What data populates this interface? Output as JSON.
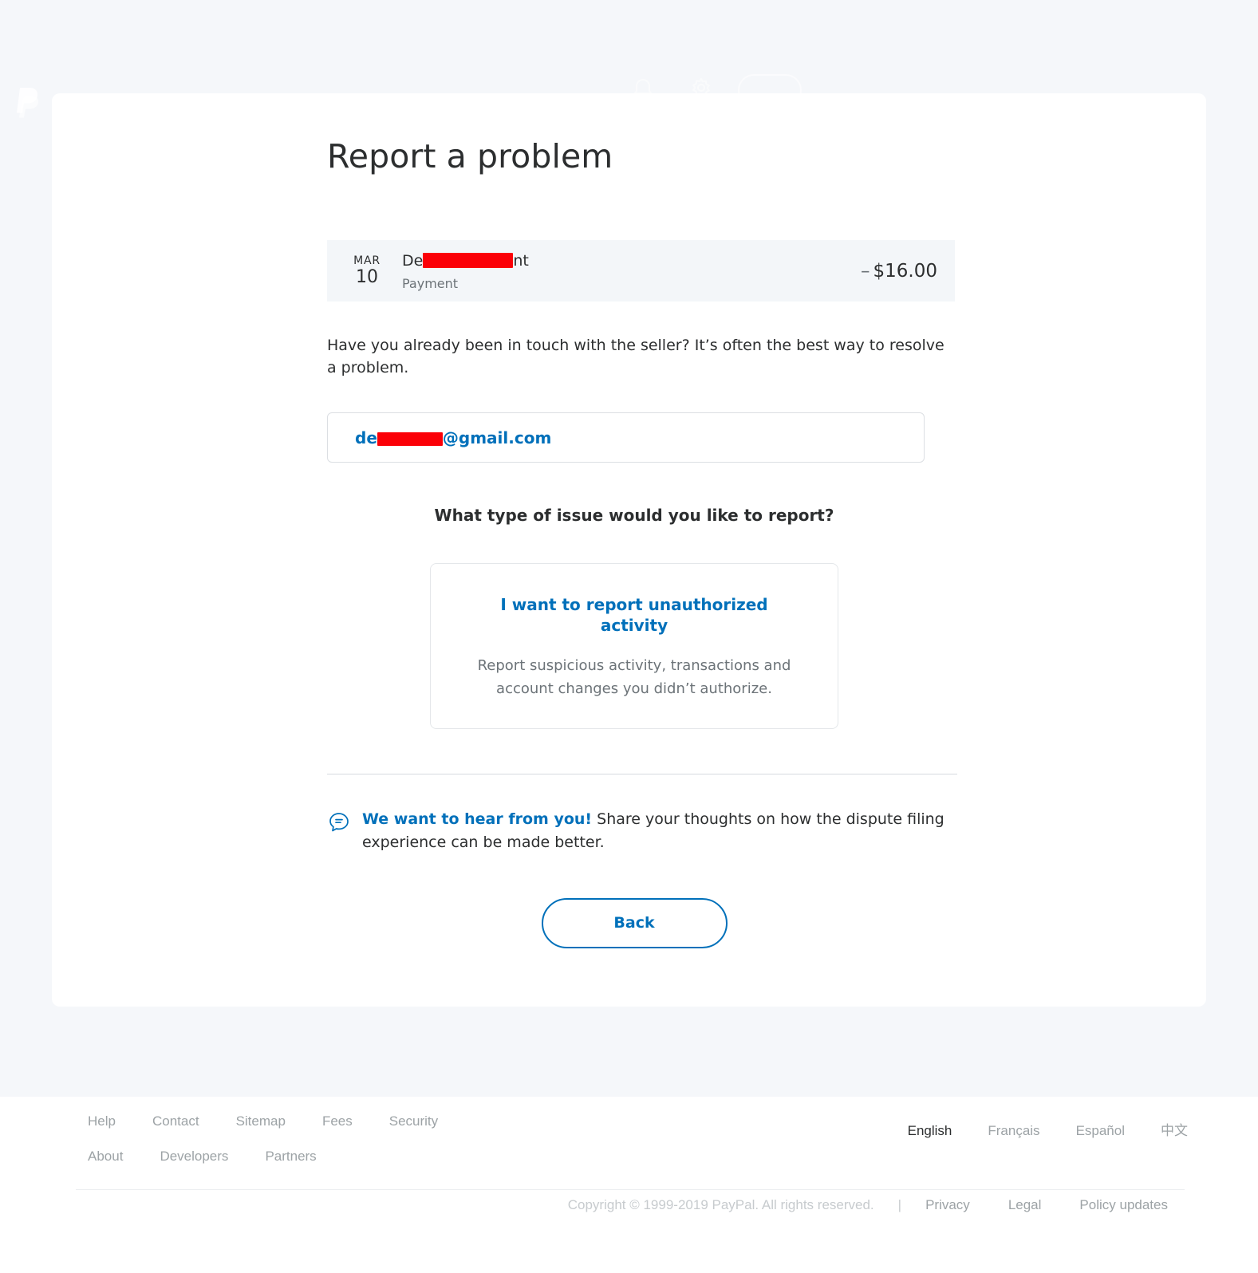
{
  "brand": {
    "logo_icon": "paypal-logo-icon",
    "accent_color": "#0070ba",
    "text_color": "#2c2e2f",
    "muted_color": "#6c7378",
    "page_bg": "#f5f7fa",
    "row_bg": "#f3f6f9",
    "redaction_color": "#fb0007"
  },
  "header": {
    "bell_icon": "bell-icon",
    "gear_icon": "gear-icon",
    "pill_button_label": ""
  },
  "main": {
    "title": "Report a problem",
    "transaction": {
      "month": "MAR",
      "day": "10",
      "merchant_prefix": "De",
      "merchant_suffix": "nt",
      "type": "Payment",
      "amount_sign": "–",
      "amount": "$16.00"
    },
    "seller_question": "Have you already been in touch with the seller? It’s often the best way to resolve a problem.",
    "email": {
      "prefix": "de",
      "suffix": "@gmail.com"
    },
    "issue_question": "What type of issue would you like to report?",
    "options": [
      {
        "title": "I want to report unauthorized activity",
        "description": "Report suspicious activity, transactions and account changes you didn’t authorize."
      }
    ],
    "feedback": {
      "icon": "chat-bubble-icon",
      "link_text": "We want to hear from you!",
      "body_text": " Share your thoughts on how the dispute filing experience can be made better."
    },
    "back_button": "Back"
  },
  "footer": {
    "links_row1": [
      "Help",
      "Contact",
      "Sitemap",
      "Fees",
      "Security"
    ],
    "links_row2": [
      "About",
      "Developers",
      "Partners"
    ],
    "languages": [
      {
        "label": "English",
        "active": true
      },
      {
        "label": "Français",
        "active": false
      },
      {
        "label": "Español",
        "active": false
      },
      {
        "label": "中文",
        "active": false
      }
    ],
    "copyright": "Copyright © 1999-2019 PayPal. All rights reserved.",
    "separator": "|",
    "legal_links": [
      "Privacy",
      "Legal",
      "Policy updates"
    ]
  }
}
